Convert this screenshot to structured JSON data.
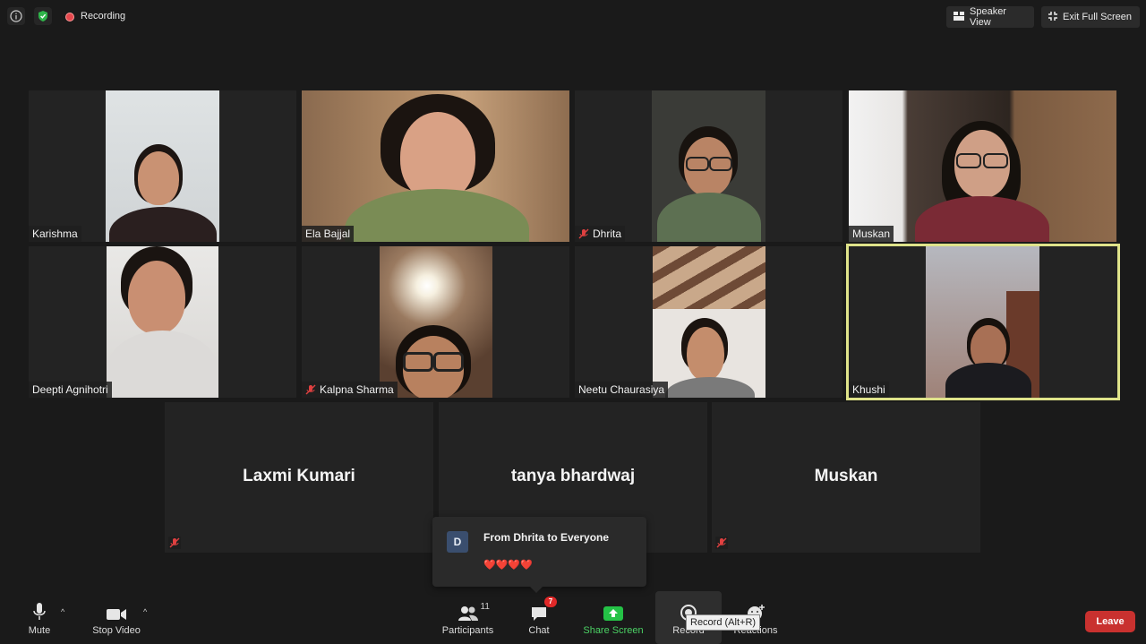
{
  "topbar": {
    "recording_label": "Recording",
    "speaker_view_label": "Speaker View",
    "exit_fullscreen_label": "Exit Full Screen"
  },
  "participants_grid": [
    {
      "name": "Karishma",
      "muted": false
    },
    {
      "name": "Ela Bajjal",
      "muted": false
    },
    {
      "name": "Dhrita",
      "muted": true
    },
    {
      "name": "Muskan",
      "muted": false
    },
    {
      "name": "Deepti Agnihotri",
      "muted": false
    },
    {
      "name": "Kalpna Sharma",
      "muted": true
    },
    {
      "name": "Neetu Chaurasiya",
      "muted": false
    },
    {
      "name": "Khushi",
      "muted": false,
      "active_speaker": true
    }
  ],
  "no_video_tiles": [
    {
      "name": "Laxmi Kumari",
      "muted": true
    },
    {
      "name": "tanya bhardwaj",
      "muted": false
    },
    {
      "name": "Muskan",
      "muted": true
    }
  ],
  "chat_popup": {
    "avatar_initial": "D",
    "from": "From Dhrita to Everyone",
    "message": "❤️❤️❤️❤️"
  },
  "toolbar": {
    "mute_label": "Mute",
    "stop_video_label": "Stop Video",
    "participants_label": "Participants",
    "participants_count": "11",
    "chat_label": "Chat",
    "chat_badge": "7",
    "share_screen_label": "Share Screen",
    "record_label": "Record",
    "reactions_label": "Reactions",
    "record_tooltip": "Record (Alt+R)",
    "leave_label": "Leave"
  },
  "colors": {
    "background": "#1a1a1a",
    "active_speaker_border": "#dfe38a",
    "share_green": "#4bd164",
    "leave_red": "#c9312f",
    "recording_red": "#e5484d"
  }
}
